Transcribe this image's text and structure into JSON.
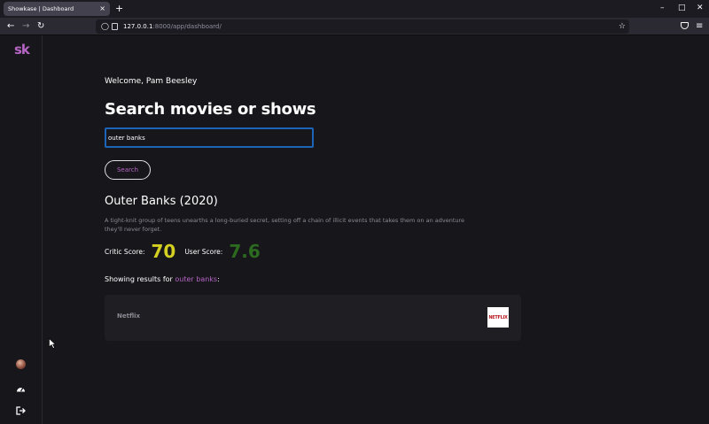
{
  "browser": {
    "tab_title": "Showkase | Dashboard",
    "tab_close": "×",
    "new_tab": "+",
    "url_host": "127.0.0.1",
    "url_rest": ":8000/app/dashboard/",
    "icons": [
      "back-icon",
      "forward-icon",
      "reload-icon",
      "shield-icon",
      "lock-icon",
      "star-icon",
      "pocket-icon",
      "menu-icon"
    ]
  },
  "window_controls": {
    "minimize": "–",
    "maximize": "□",
    "close": "✕"
  },
  "sidebar": {
    "logo": "sk",
    "icons": [
      "avatar",
      "gauge-icon",
      "logout-icon"
    ]
  },
  "main": {
    "welcome": "Welcome, Pam Beesley",
    "title": "Search movies or shows",
    "search_value": "outer banks",
    "search_button": "Search",
    "result": {
      "title": "Outer Banks (2020)",
      "overview": "A tight-knit group of teens unearths a long-buried secret, setting off a chain of illicit events that takes them on an adventure they'll never forget.",
      "critic_label": "Critic Score:",
      "critic_score": "70",
      "user_label": "User Score:",
      "user_score": "7.6"
    },
    "showing_prefix": "Showing results for ",
    "showing_query": "outer banks",
    "showing_suffix": ":",
    "providers": [
      {
        "name": "Netflix",
        "logo_text": "NETFLIX"
      }
    ]
  },
  "colors": {
    "accent": "#b665c5",
    "critic": "#d4d021",
    "user": "#2c6b1f",
    "input_border": "#1b64b8"
  }
}
